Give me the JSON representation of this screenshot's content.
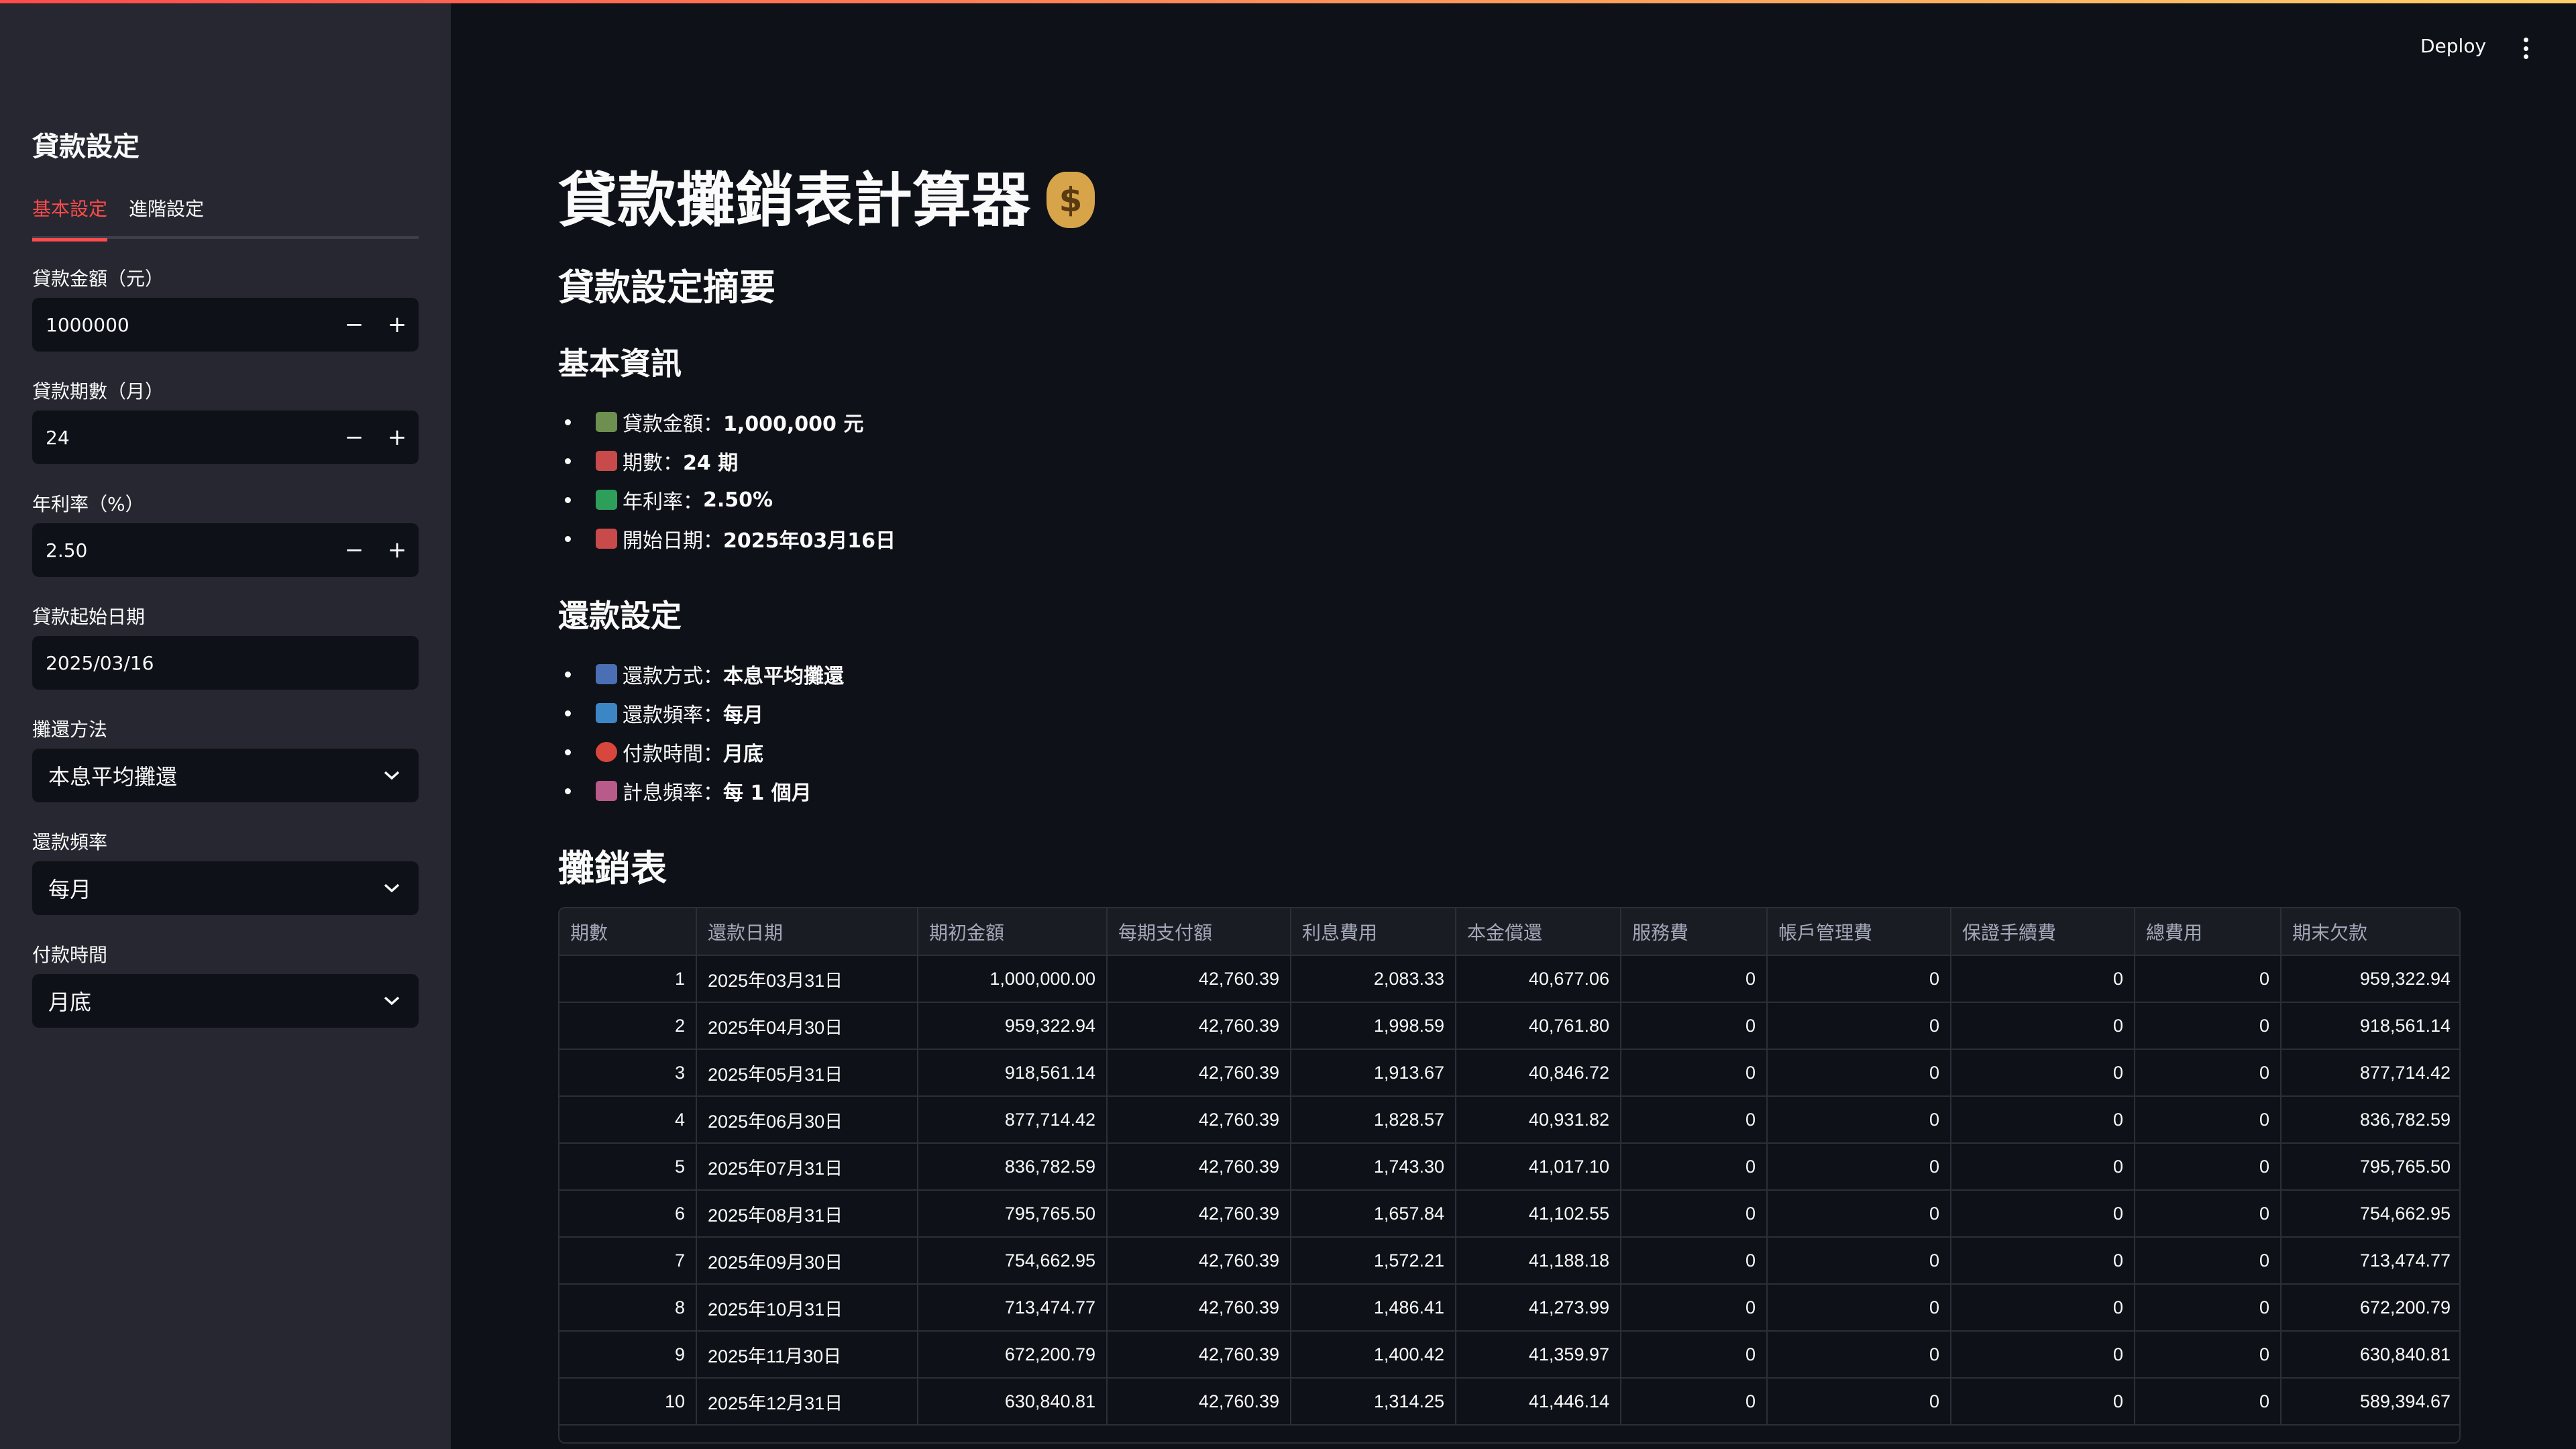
{
  "header": {
    "deploy_label": "Deploy",
    "menu_icon": "kebab-menu-icon"
  },
  "sidebar": {
    "title": "貸款設定",
    "tabs": [
      "基本設定",
      "進階設定"
    ],
    "active_tab": "基本設定",
    "fields": {
      "amount": {
        "label": "貸款金額（元）",
        "value": "1000000"
      },
      "periods": {
        "label": "貸款期數（月）",
        "value": "24"
      },
      "rate": {
        "label": "年利率（%）",
        "value": "2.50"
      },
      "start_date": {
        "label": "貸款起始日期",
        "value": "2025/03/16"
      },
      "method": {
        "label": "攤還方法",
        "value": "本息平均攤還"
      },
      "frequency": {
        "label": "還款頻率",
        "value": "每月"
      },
      "timing": {
        "label": "付款時間",
        "value": "月底"
      }
    },
    "stepper_minus": "−",
    "stepper_plus": "+"
  },
  "main": {
    "title": "貸款攤銷表計算器",
    "title_icon": "money-bag-icon",
    "title_icon_glyph": "$",
    "summary_heading": "貸款設定摘要",
    "basic_heading": "基本資訊",
    "basic_items": [
      {
        "icon": "banknote-icon",
        "label": "貸款金額：",
        "value": "1,000,000 元"
      },
      {
        "icon": "calendar-icon",
        "label": "期數：",
        "value": "24 期"
      },
      {
        "icon": "chart-increasing-icon",
        "label": "年利率：",
        "value": "2.50%"
      },
      {
        "icon": "calendar-icon",
        "label": "開始日期：",
        "value": "2025年03月16日"
      }
    ],
    "repay_heading": "還款設定",
    "repay_items": [
      {
        "icon": "bar-chart-icon",
        "label": "還款方式：",
        "value": "本息平均攤還"
      },
      {
        "icon": "refresh-icon",
        "label": "還款頻率：",
        "value": "每月"
      },
      {
        "icon": "alarm-clock-icon",
        "label": "付款時間：",
        "value": "月底"
      },
      {
        "icon": "chart-up-icon",
        "label": "計息頻率：",
        "value": "每 1 個月"
      }
    ],
    "table_heading": "攤銷表",
    "table": {
      "columns": [
        "期數",
        "還款日期",
        "期初金額",
        "每期支付額",
        "利息費用",
        "本金償還",
        "服務費",
        "帳戶管理費",
        "保證手續費",
        "總費用",
        "期末欠款"
      ],
      "rows": [
        [
          "1",
          "2025年03月31日",
          "1,000,000.00",
          "42,760.39",
          "2,083.33",
          "40,677.06",
          "0",
          "0",
          "0",
          "0",
          "959,322.94"
        ],
        [
          "2",
          "2025年04月30日",
          "959,322.94",
          "42,760.39",
          "1,998.59",
          "40,761.80",
          "0",
          "0",
          "0",
          "0",
          "918,561.14"
        ],
        [
          "3",
          "2025年05月31日",
          "918,561.14",
          "42,760.39",
          "1,913.67",
          "40,846.72",
          "0",
          "0",
          "0",
          "0",
          "877,714.42"
        ],
        [
          "4",
          "2025年06月30日",
          "877,714.42",
          "42,760.39",
          "1,828.57",
          "40,931.82",
          "0",
          "0",
          "0",
          "0",
          "836,782.59"
        ],
        [
          "5",
          "2025年07月31日",
          "836,782.59",
          "42,760.39",
          "1,743.30",
          "41,017.10",
          "0",
          "0",
          "0",
          "0",
          "795,765.50"
        ],
        [
          "6",
          "2025年08月31日",
          "795,765.50",
          "42,760.39",
          "1,657.84",
          "41,102.55",
          "0",
          "0",
          "0",
          "0",
          "754,662.95"
        ],
        [
          "7",
          "2025年09月30日",
          "754,662.95",
          "42,760.39",
          "1,572.21",
          "41,188.18",
          "0",
          "0",
          "0",
          "0",
          "713,474.77"
        ],
        [
          "8",
          "2025年10月31日",
          "713,474.77",
          "42,760.39",
          "1,486.41",
          "41,273.99",
          "0",
          "0",
          "0",
          "0",
          "672,200.79"
        ],
        [
          "9",
          "2025年11月30日",
          "672,200.79",
          "42,760.39",
          "1,400.42",
          "41,359.97",
          "0",
          "0",
          "0",
          "0",
          "630,840.81"
        ],
        [
          "10",
          "2025年12月31日",
          "630,840.81",
          "42,760.39",
          "1,314.25",
          "41,446.14",
          "0",
          "0",
          "0",
          "0",
          "589,394.67"
        ]
      ]
    }
  },
  "colors": {
    "accent": "#ff4b4b",
    "background": "#0e1117",
    "sidebar": "#262730"
  }
}
